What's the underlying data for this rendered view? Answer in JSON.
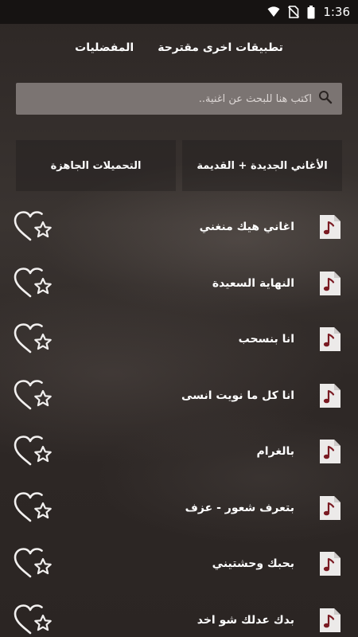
{
  "status_bar": {
    "time": "1:36",
    "icons": [
      "wifi-icon",
      "no-sim-icon",
      "battery-icon"
    ]
  },
  "top_nav": {
    "suggested_apps": "تطبيقات اخرى مقترحة",
    "favorites": "المفضليات"
  },
  "search": {
    "placeholder": "اكتب هنا للبحث عن اغنية..",
    "value": ""
  },
  "tabs": {
    "new_old_songs": "الأغاني الجديدة + القديمة",
    "ready_downloads": "التحميلات الجاهزة"
  },
  "songs": [
    {
      "title": "اغاني هيك منغني",
      "icon": "music-note-icon",
      "fav_icon": "heart-star-icon"
    },
    {
      "title": "النهاية السعيدة",
      "icon": "music-note-icon",
      "fav_icon": "heart-star-icon"
    },
    {
      "title": "انا بنسحب",
      "icon": "music-note-icon",
      "fav_icon": "heart-star-icon"
    },
    {
      "title": "انا كل ما نويت انسى",
      "icon": "music-note-icon",
      "fav_icon": "heart-star-icon"
    },
    {
      "title": "بالغرام",
      "icon": "music-note-icon",
      "fav_icon": "heart-star-icon"
    },
    {
      "title": "بتعرف شعور - عزف",
      "icon": "music-note-icon",
      "fav_icon": "heart-star-icon"
    },
    {
      "title": "بحبك وحشتيني",
      "icon": "music-note-icon",
      "fav_icon": "heart-star-icon"
    },
    {
      "title": "بدك عدلك شو اخد",
      "icon": "music-note-icon",
      "fav_icon": "heart-star-icon"
    }
  ],
  "colors": {
    "status_bar_bg": "#161312",
    "search_bg": "#7b7472",
    "note_icon_bg": "#eceae9",
    "note_color": "#7a1a22"
  }
}
